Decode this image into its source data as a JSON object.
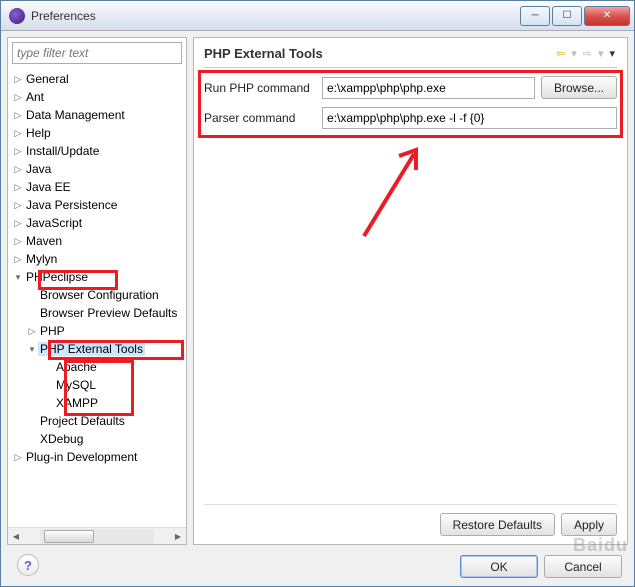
{
  "window": {
    "title": "Preferences"
  },
  "filter": {
    "placeholder": "type filter text"
  },
  "tree": {
    "items": [
      {
        "label": "General",
        "indent": 0,
        "arrow": "▷"
      },
      {
        "label": "Ant",
        "indent": 0,
        "arrow": "▷"
      },
      {
        "label": "Data Management",
        "indent": 0,
        "arrow": "▷"
      },
      {
        "label": "Help",
        "indent": 0,
        "arrow": "▷"
      },
      {
        "label": "Install/Update",
        "indent": 0,
        "arrow": "▷"
      },
      {
        "label": "Java",
        "indent": 0,
        "arrow": "▷"
      },
      {
        "label": "Java EE",
        "indent": 0,
        "arrow": "▷"
      },
      {
        "label": "Java Persistence",
        "indent": 0,
        "arrow": "▷"
      },
      {
        "label": "JavaScript",
        "indent": 0,
        "arrow": "▷"
      },
      {
        "label": "Maven",
        "indent": 0,
        "arrow": "▷"
      },
      {
        "label": "Mylyn",
        "indent": 0,
        "arrow": "▷"
      },
      {
        "label": "PHPeclipse",
        "indent": 0,
        "arrow": "▾"
      },
      {
        "label": "Browser Configuration",
        "indent": 1,
        "arrow": ""
      },
      {
        "label": "Browser Preview Defaults",
        "indent": 1,
        "arrow": ""
      },
      {
        "label": "PHP",
        "indent": 1,
        "arrow": "▷"
      },
      {
        "label": "PHP External Tools",
        "indent": 1,
        "arrow": "▾",
        "selected": true
      },
      {
        "label": "Apache",
        "indent": 2,
        "arrow": ""
      },
      {
        "label": "MySQL",
        "indent": 2,
        "arrow": ""
      },
      {
        "label": "XAMPP",
        "indent": 2,
        "arrow": ""
      },
      {
        "label": "Project Defaults",
        "indent": 1,
        "arrow": ""
      },
      {
        "label": "XDebug",
        "indent": 1,
        "arrow": ""
      },
      {
        "label": "Plug-in Development",
        "indent": 0,
        "arrow": "▷"
      }
    ]
  },
  "page": {
    "title": "PHP External Tools",
    "run_label": "Run PHP command",
    "run_value": "e:\\xampp\\php\\php.exe",
    "browse_label": "Browse...",
    "parser_label": "Parser command",
    "parser_value": "e:\\xampp\\php\\php.exe -l -f {0}",
    "restore_label": "Restore Defaults",
    "apply_label": "Apply"
  },
  "footer": {
    "ok": "OK",
    "cancel": "Cancel"
  },
  "watermark": "Baidu"
}
